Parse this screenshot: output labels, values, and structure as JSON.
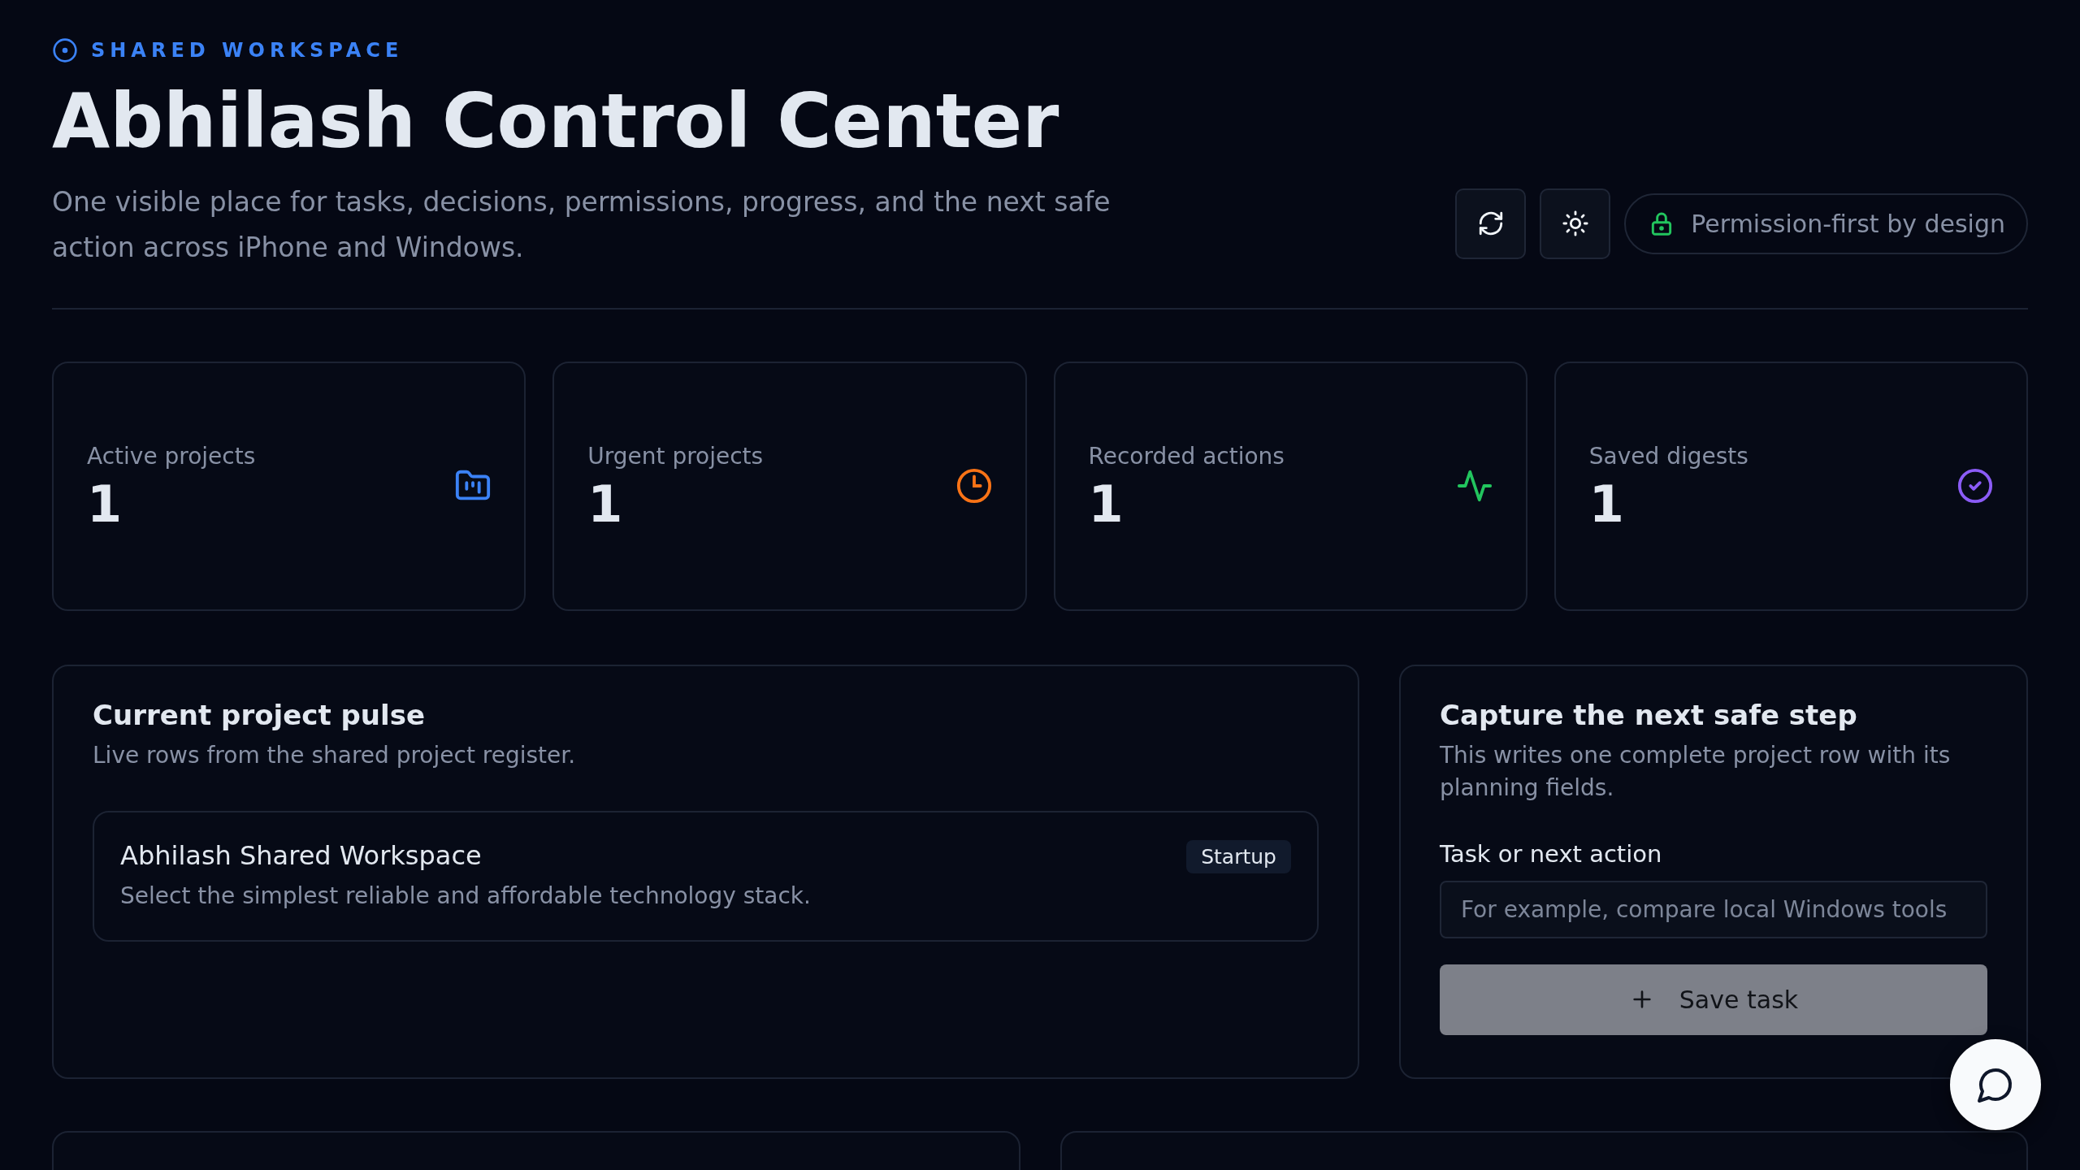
{
  "header": {
    "eyebrow": "SHARED WORKSPACE",
    "title": "Abhilash Control Center",
    "subtitle": "One visible place for tasks, decisions, permissions, progress, and the next safe action across iPhone and Windows.",
    "badge": "Permission-first by design"
  },
  "stats": [
    {
      "label": "Active projects",
      "value": "1",
      "color": "#3b82f6"
    },
    {
      "label": "Urgent projects",
      "value": "1",
      "color": "#f97316"
    },
    {
      "label": "Recorded actions",
      "value": "1",
      "color": "#22c55e"
    },
    {
      "label": "Saved digests",
      "value": "1",
      "color": "#8b5cf6"
    }
  ],
  "pulse": {
    "title": "Current project pulse",
    "subtitle": "Live rows from the shared project register.",
    "projects": [
      {
        "name": "Abhilash Shared Workspace",
        "description": "Select the simplest reliable and affordable technology stack.",
        "tag": "Startup"
      }
    ]
  },
  "capture": {
    "title": "Capture the next safe step",
    "subtitle": "This writes one complete project row with its planning fields.",
    "field_label": "Task or next action",
    "placeholder": "For example, compare local Windows tools",
    "button": {
      "label": "Save task",
      "disabled": true
    }
  }
}
